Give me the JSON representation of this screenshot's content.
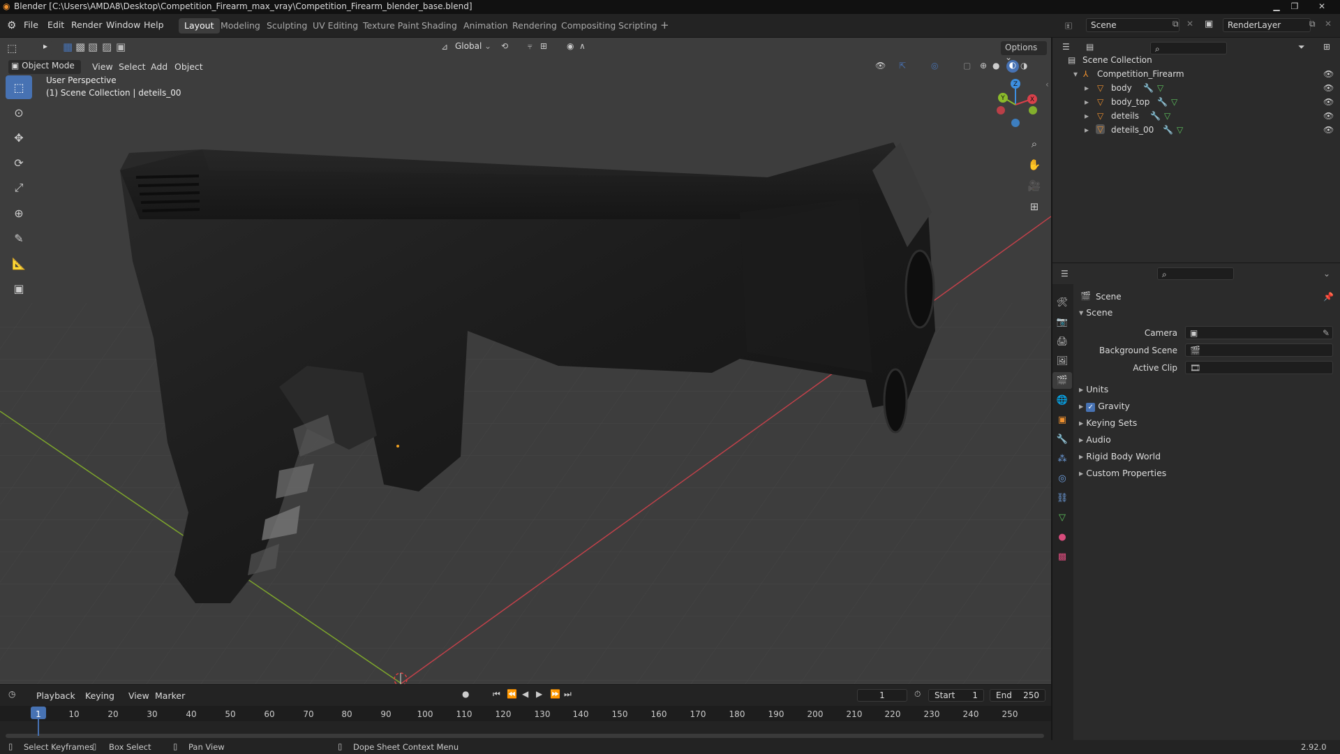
{
  "window": {
    "title": "Blender [C:\\Users\\AMDA8\\Desktop\\Competition_Firearm_max_vray\\Competition_Firearm_blender_base.blend]"
  },
  "menus": [
    "File",
    "Edit",
    "Render",
    "Window",
    "Help"
  ],
  "workspaces": [
    "Layout",
    "Modeling",
    "Sculpting",
    "UV Editing",
    "Texture Paint",
    "Shading",
    "Animation",
    "Rendering",
    "Compositing",
    "Scripting"
  ],
  "active_workspace": "Layout",
  "top_right": {
    "scene": "Scene",
    "render_layer": "RenderLayer"
  },
  "viewport_header": {
    "transform_orientation": "Global",
    "options_label": "Options",
    "mode": "Object Mode",
    "menus": [
      "View",
      "Select",
      "Add",
      "Object"
    ]
  },
  "viewport": {
    "perspective": "User Perspective",
    "context": "(1) Scene Collection | deteils_00",
    "gizmo_axes": [
      "X",
      "Y",
      "Z"
    ]
  },
  "outliner": {
    "root": "Scene Collection",
    "collection": "Competition_Firearm",
    "objects": [
      "body",
      "body_top",
      "deteils",
      "deteils_00"
    ]
  },
  "properties": {
    "context_title": "Scene",
    "section_scene": "Scene",
    "fields": [
      {
        "label": "Camera"
      },
      {
        "label": "Background Scene"
      },
      {
        "label": "Active Clip"
      }
    ],
    "panels": [
      "Units",
      "Gravity",
      "Keying Sets",
      "Audio",
      "Rigid Body World",
      "Custom Properties"
    ],
    "gravity_checked": true
  },
  "timeline": {
    "menus": [
      "Playback",
      "Keying",
      "View",
      "Marker"
    ],
    "current_frame": "1",
    "start_label": "Start",
    "start": "1",
    "end_label": "End",
    "end": "250",
    "ruler": [
      "1",
      "10",
      "20",
      "30",
      "40",
      "50",
      "60",
      "70",
      "80",
      "90",
      "100",
      "110",
      "120",
      "130",
      "140",
      "150",
      "160",
      "170",
      "180",
      "190",
      "200",
      "210",
      "220",
      "230",
      "240",
      "250"
    ]
  },
  "statusbar": {
    "items": [
      "Select Keyframes",
      "Box Select",
      "Pan View",
      "Dope Sheet Context Menu"
    ],
    "version": "2.92.0"
  },
  "colors": {
    "accent": "#4772b3",
    "x_axis": "#d9404a",
    "y_axis": "#8bbb2b",
    "z_axis": "#3d8fe0"
  }
}
